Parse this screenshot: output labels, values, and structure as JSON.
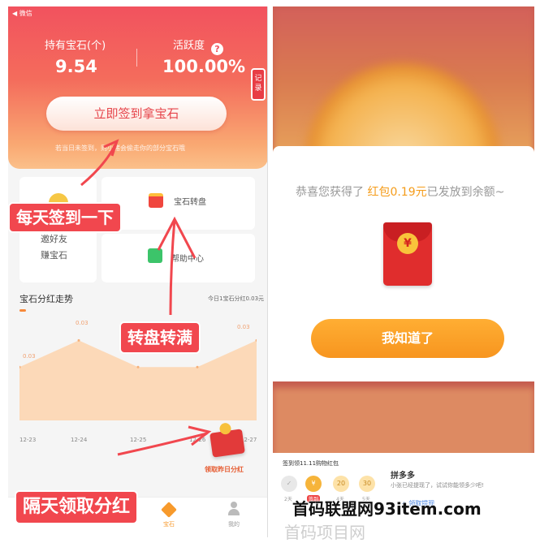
{
  "left_screen": {
    "back_link": "◀ 微信",
    "stats": [
      {
        "label": "持有宝石(个)",
        "value": "9.54"
      },
      {
        "label": "活跃度",
        "value": "100.00%"
      }
    ],
    "help_icon": "?",
    "records_tab": "记录",
    "signin_button": "立即签到拿宝石",
    "signin_hint": "若当日未签到，则小猪会偷走你的部分宝石哦",
    "cards": {
      "invite_line1": "邀好友",
      "invite_line2": "赚宝石",
      "wheel": "宝石转盘",
      "help_center": "帮助中心"
    },
    "trend": {
      "title": "宝石分红走势",
      "today": "今日1宝石分红0.03元"
    },
    "redeem_label": "领取昨日分红",
    "nav": {
      "gems": "宝石",
      "mine": "我的"
    }
  },
  "chart_data": {
    "type": "area",
    "x": [
      "12-23",
      "12-24",
      "12-25",
      "12-26",
      "12-27"
    ],
    "values": [
      0.02,
      0.03,
      0.02,
      0.02,
      0.03
    ],
    "labels": [
      "0.03",
      "0.03",
      "0.03"
    ],
    "color": "#fcd9b8"
  },
  "callouts": {
    "daily_signin": "每天签到一下",
    "wheel_full": "转盘转满",
    "next_day": "隔天领取分红"
  },
  "right_screen": {
    "modal_prefix": "恭喜您获得了",
    "modal_amount": "红包0.19元",
    "modal_suffix": "已发放到余额~",
    "envelope_symbol": "¥",
    "got_it_button": "我知道了",
    "strip_title": "签到领11.11购物红包",
    "days": [
      {
        "value": "",
        "label": "2天"
      },
      {
        "value": "¥",
        "label": "签到"
      },
      {
        "value": "20",
        "label": "4天"
      },
      {
        "value": "30",
        "label": "5天"
      }
    ],
    "pdd_title": "拼多多",
    "pdd_desc": "小张已经提现了，试试你能领多少吧!",
    "pdd_link": "+ 领取提现"
  },
  "watermark": "首码联盟网93item.com",
  "watermark2": "首码项目网"
}
